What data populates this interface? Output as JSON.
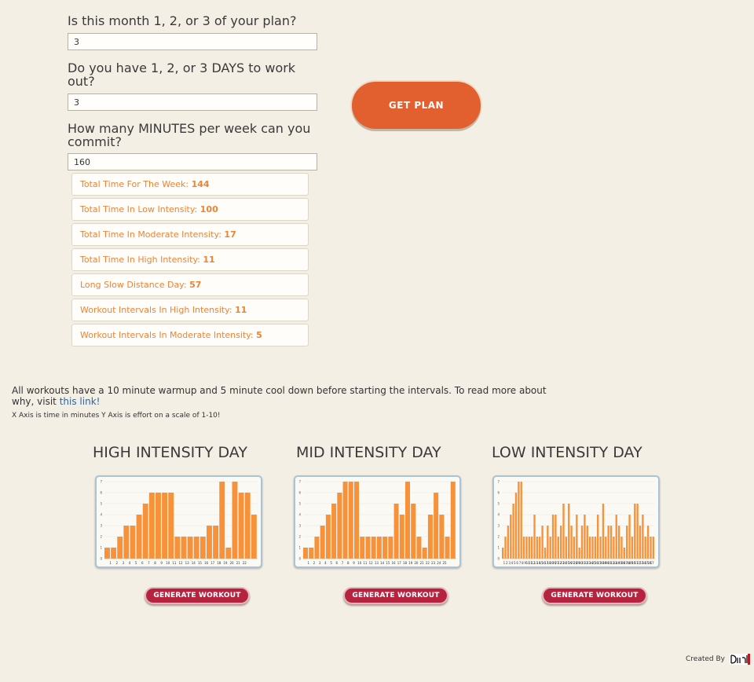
{
  "form": {
    "q1": "Is this month 1, 2, or 3 of your plan?",
    "a1": "3",
    "q2": "Do you have 1, 2, or 3 DAYS to work out?",
    "a2": "3",
    "q3": "How many MINUTES per week can you commit?",
    "a3": "160",
    "get_plan_label": "GET PLAN"
  },
  "results": [
    {
      "label": "Total Time For The Week:",
      "value": "144"
    },
    {
      "label": "Total Time In Low Intensity:",
      "value": "100"
    },
    {
      "label": "Total Time In Moderate Intensity:",
      "value": "17"
    },
    {
      "label": "Total Time In High Intensity:",
      "value": "11"
    },
    {
      "label": "Long Slow Distance Day:",
      "value": "57"
    },
    {
      "label": "Workout Intervals In High Intensity:",
      "value": "11"
    },
    {
      "label": "Workout Intervals In Moderate Intensity:",
      "value": "5"
    }
  ],
  "info": {
    "text": "All workouts have a 10 minute warmup and 5 minute cool down before starting the intervals. To read more about why, visit",
    "link": "this link!",
    "axis_note": "X Axis is time in minutes Y Axis is effort on a scale of 1-10!"
  },
  "generate_label": "GENERATE WORKOUT",
  "footer": {
    "created_by": "Created By"
  },
  "colors": {
    "accent": "#e2602f",
    "bar": "#f7923a",
    "result_text": "#ee8333",
    "generate": "#b5233f"
  },
  "chart_data": [
    {
      "type": "bar",
      "title": "HIGH INTENSITY DAY",
      "ylim": [
        0,
        7
      ],
      "x": [
        1,
        2,
        3,
        4,
        5,
        6,
        7,
        8,
        9,
        10,
        11,
        12,
        13,
        14,
        15,
        16,
        17,
        18,
        19,
        20,
        21,
        22
      ],
      "values": [
        1,
        1,
        2,
        3,
        3,
        4,
        5,
        6,
        6,
        6,
        6,
        2,
        2,
        2,
        2,
        2,
        3,
        3,
        7,
        1,
        7,
        6,
        6,
        4
      ],
      "ytick_labels": [
        "0",
        "1",
        "2",
        "3",
        "4",
        "5",
        "6",
        "7"
      ]
    },
    {
      "type": "bar",
      "title": "MID INTENSITY DAY",
      "ylim": [
        0,
        7
      ],
      "x": [
        1,
        2,
        3,
        4,
        5,
        6,
        7,
        8,
        9,
        10,
        11,
        12,
        13,
        14,
        15,
        16,
        17,
        18,
        19,
        20,
        21,
        22,
        23,
        24,
        25
      ],
      "values": [
        1,
        1,
        2,
        3,
        4,
        5,
        6,
        7,
        7,
        7,
        2,
        2,
        2,
        2,
        2,
        2,
        5,
        4,
        7,
        5,
        2,
        1,
        4,
        6,
        4,
        2,
        7
      ],
      "ytick_labels": [
        "0",
        "1",
        "2",
        "3",
        "4",
        "5",
        "6",
        "7"
      ]
    },
    {
      "type": "bar",
      "title": "LOW INTENSITY DAY",
      "ylim": [
        0,
        7
      ],
      "x": [
        1,
        2,
        3,
        4,
        5,
        6,
        7,
        8,
        9,
        10,
        11,
        12,
        13,
        14,
        15,
        16,
        17,
        18,
        19,
        20,
        21,
        22,
        23,
        24,
        25,
        26,
        27,
        28,
        29,
        30,
        31,
        32,
        33,
        34,
        35,
        36,
        37,
        38,
        39,
        40,
        41,
        42,
        43,
        44,
        45,
        46,
        47,
        48,
        49,
        50,
        51,
        52,
        53,
        54,
        55,
        56,
        57
      ],
      "values": [
        1,
        2,
        3,
        4,
        5,
        6,
        7,
        7,
        2,
        2,
        2,
        2,
        4,
        2,
        2,
        3,
        1,
        3,
        2,
        4,
        4,
        2,
        3,
        5,
        2,
        5,
        3,
        2,
        4,
        1,
        3,
        4,
        3,
        2,
        2,
        2,
        4,
        2,
        5,
        2,
        3,
        3,
        2,
        4,
        3,
        2,
        1,
        3,
        4,
        2,
        5,
        5,
        3,
        4,
        2,
        3,
        2,
        2
      ],
      "ytick_labels": [
        "0",
        "1",
        "2",
        "3",
        "4",
        "5",
        "6",
        "7"
      ]
    }
  ]
}
